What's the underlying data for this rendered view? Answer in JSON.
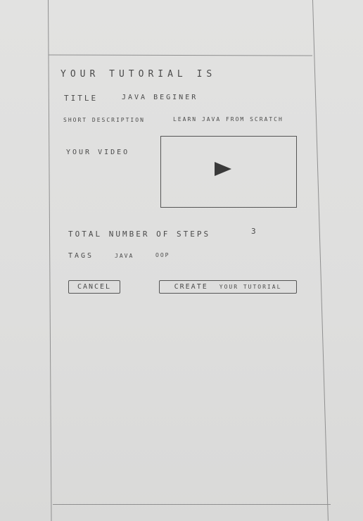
{
  "heading": "YOUR TUTORIAL IS",
  "title": {
    "label": "TITLE",
    "value": "JAVA BEGINER"
  },
  "description": {
    "label": "SHORT DESCRIPTION",
    "value": "LEARN JAVA FROM SCRATCH"
  },
  "video": {
    "label": "YOUR VIDEO",
    "icon": "play-icon"
  },
  "steps": {
    "label": "TOTAL NUMBER OF STEPS",
    "value": "3"
  },
  "tags": {
    "label": "TAGS",
    "items": [
      "JAVA",
      "OOP"
    ]
  },
  "buttons": {
    "cancel": "CANCEL",
    "create_text": "CREATE",
    "create_rest": "YOUR TUTORIAL"
  }
}
